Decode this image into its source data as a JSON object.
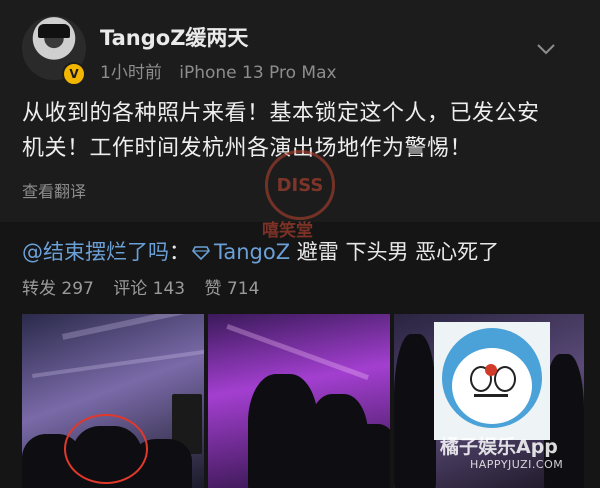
{
  "user": {
    "name": "TangoZ缓两天",
    "time": "1小时前",
    "device": "iPhone 13 Pro Max",
    "verified_badge": "V"
  },
  "post": {
    "line1": "从收到的各种照片来看！基本锁定这个人，已发公安",
    "line2": "机关！工作时间发杭州各演出场地作为警惕！",
    "translate_label": "查看翻译"
  },
  "watermark": {
    "badge": "DISS",
    "text": "嘻笑堂"
  },
  "repost": {
    "user_link": "@结束摆烂了吗",
    "colon": "：",
    "quoted_user": "TangoZ",
    "comment": " 避雷 下头男 恶心死了"
  },
  "stats": {
    "repost": "转发 297",
    "comment": "评论 143",
    "like": "赞 714"
  },
  "photos": [
    {
      "alt": "concert-crowd-photo"
    },
    {
      "alt": "concert-crowd-purple-photo"
    },
    {
      "alt": "doraemon-reaction-photo"
    }
  ],
  "app_watermark": {
    "name": "橘子娱乐App",
    "url": "HAPPYJUZI.COM"
  },
  "colors": {
    "background": "#151515",
    "card": "#1c1c1c",
    "link": "#6ba0d6",
    "badge": "#f2b600",
    "muted": "#8d8d8d"
  }
}
